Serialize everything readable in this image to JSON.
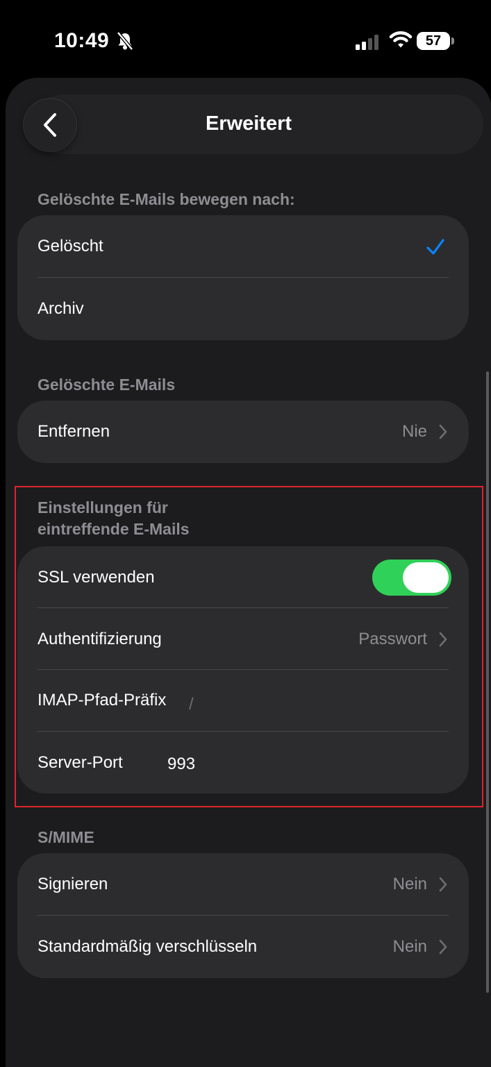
{
  "status_bar": {
    "time": "10:49",
    "battery": "57"
  },
  "nav": {
    "title": "Erweitert"
  },
  "sections": {
    "deleted_move": {
      "header": "Gelöschte E-Mails bewegen nach:",
      "options": [
        "Gelöscht",
        "Archiv"
      ],
      "selected": "Gelöscht"
    },
    "deleted_mails": {
      "header": "Gelöschte E-Mails",
      "remove_label": "Entfernen",
      "remove_value": "Nie"
    },
    "incoming": {
      "header_line1": "Einstellungen für",
      "header_line2": "eintreffende E-Mails",
      "ssl_label": "SSL verwenden",
      "ssl_enabled": true,
      "auth_label": "Authentifizierung",
      "auth_value": "Passwort",
      "imap_label": "IMAP-Pfad-Präfix",
      "imap_value": "/",
      "port_label": "Server-Port",
      "port_value": "993"
    },
    "smime": {
      "header": "S/MIME",
      "sign_label": "Signieren",
      "sign_value": "Nein",
      "encrypt_label": "Standardmäßig verschlüsseln",
      "encrypt_value": "Nein"
    }
  },
  "colors": {
    "accent_blue": "#0a84ff",
    "toggle_green": "#30d158",
    "highlight_red": "#e0242b"
  }
}
